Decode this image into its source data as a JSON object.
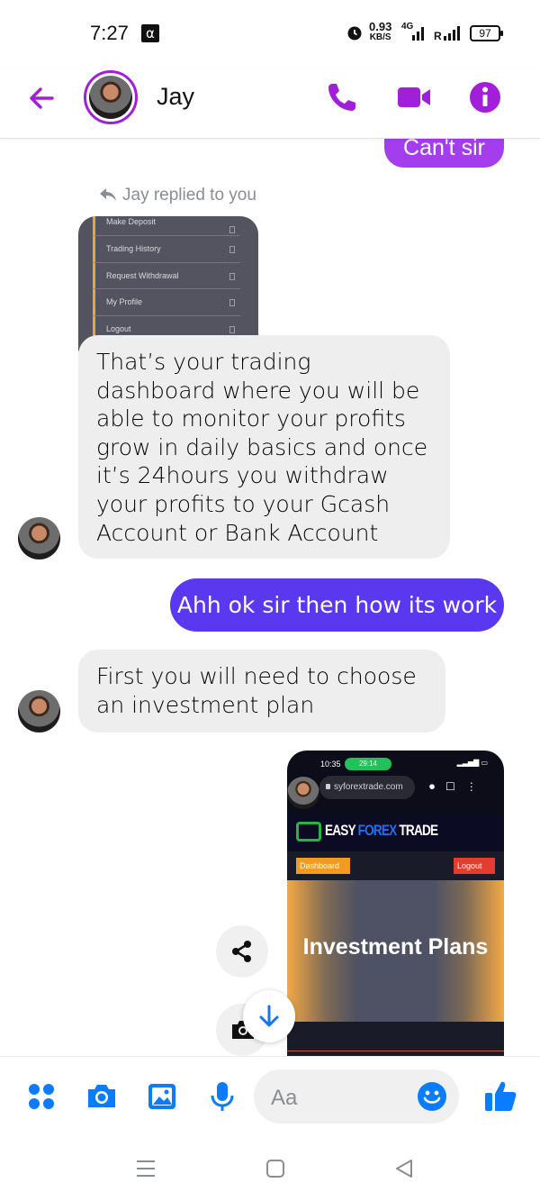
{
  "status_bar": {
    "time": "7:27",
    "alpha_glyph": "α",
    "net_speed": "0.93",
    "net_unit": "KB/S",
    "network": "4G",
    "roaming": "R",
    "battery": "97"
  },
  "header": {
    "contact_name": "Jay",
    "accent_color": "#a21fd9"
  },
  "messages": {
    "outgoing_top": "Can't sir",
    "reply_note": "Jay replied to you",
    "quoted_menu": [
      "Make Deposit",
      "Trading History",
      "Request Withdrawal",
      "My Profile",
      "Logout"
    ],
    "incoming_1": "That’s your trading dashboard where you will be able to monitor your profits grow in daily basics and once it’s 24hours you withdraw your profits to your Gcash Account or Bank Account",
    "outgoing_1": "Ahh ok sir then how its work",
    "incoming_2": "First you will need to choose an investment plan",
    "outgoing_color": "#5a38f0"
  },
  "shared_screenshot": {
    "time": "10:35",
    "call_timer": "29:14",
    "url": "syforextrade.com",
    "brand_part1": "EASY",
    "brand_part2": "FOREX",
    "brand_part3": "TRADE",
    "dashboard_label": "Dashboard",
    "logout_label": "Logout",
    "hero_title": "Investment Plans"
  },
  "composer": {
    "placeholder": "Aa"
  },
  "icons": [
    "back-arrow-icon",
    "phone-icon",
    "video-icon",
    "info-icon",
    "share-icon",
    "camera-icon",
    "chevron-down-icon",
    "apps-icon",
    "photo-icon",
    "mic-icon",
    "emoji-icon",
    "thumbs-up-icon",
    "menu-icon",
    "home-icon",
    "back-icon"
  ]
}
